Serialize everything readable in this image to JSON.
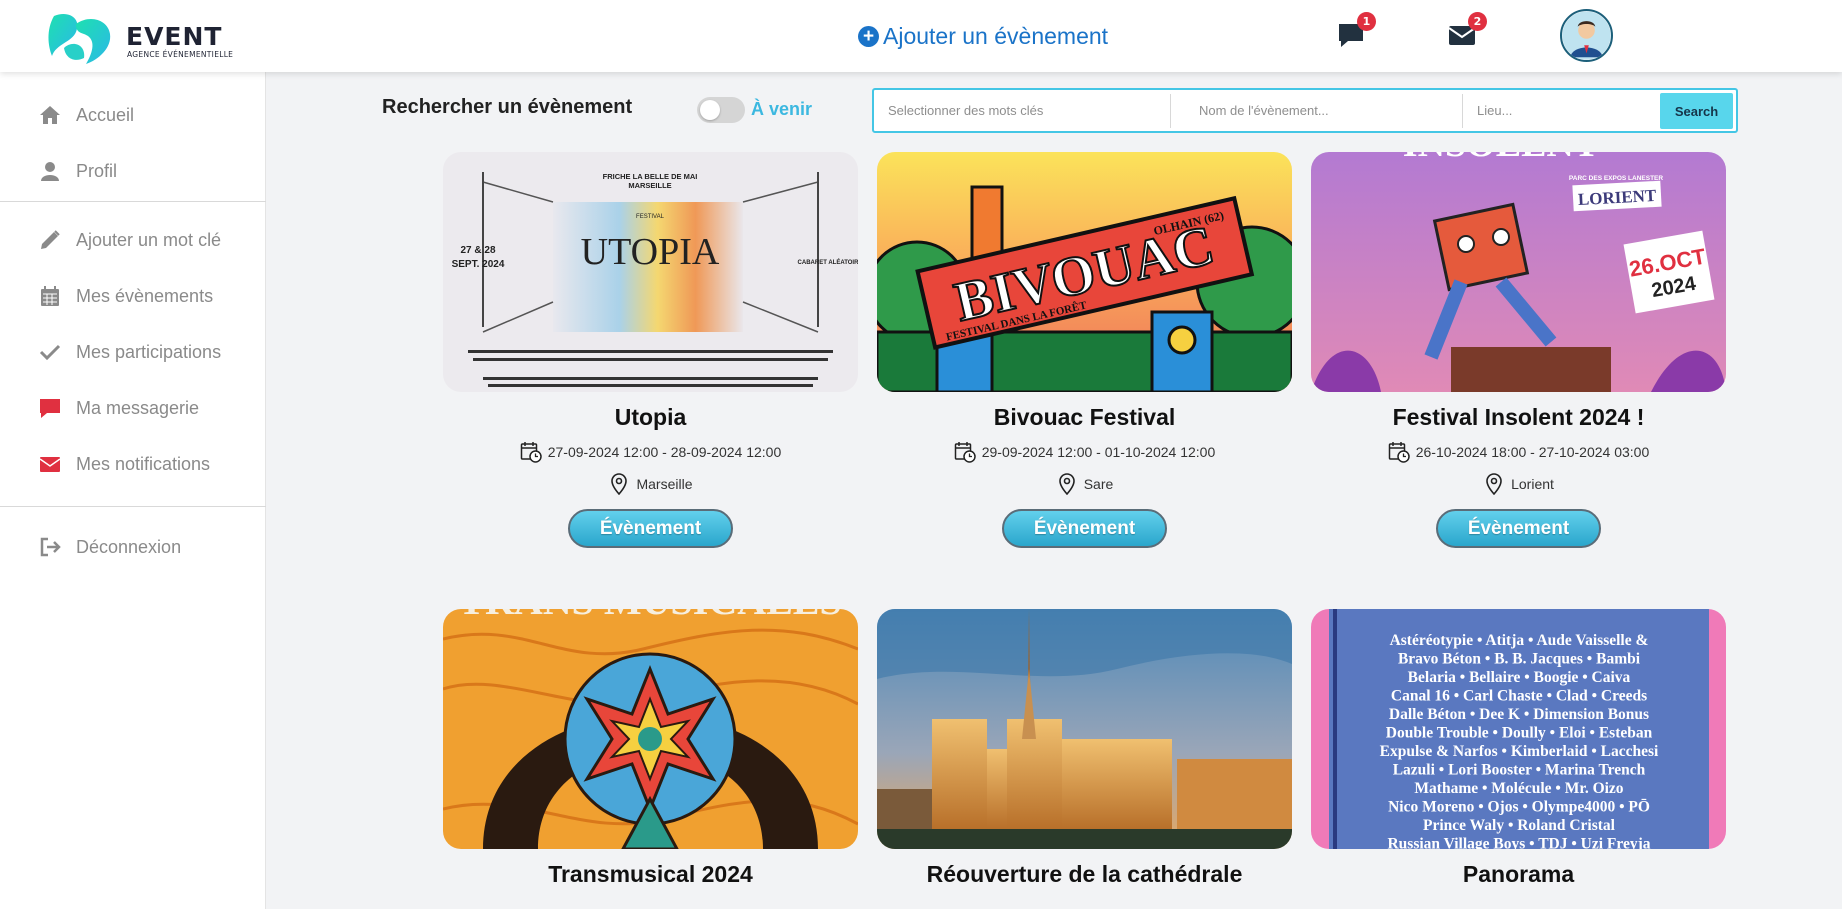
{
  "header": {
    "logo_title": "EVENT",
    "logo_subtitle": "AGENCE ÉVÉNEMENTIELLE",
    "add_event_label": "Ajouter un évènement",
    "messages_badge": "1",
    "mail_badge": "2"
  },
  "sidebar": {
    "items": [
      {
        "label": "Accueil",
        "icon": "home-icon"
      },
      {
        "label": "Profil",
        "icon": "user-icon"
      },
      {
        "label": "Ajouter un mot clé",
        "icon": "pencil-icon"
      },
      {
        "label": "Mes évènements",
        "icon": "calendar-icon"
      },
      {
        "label": "Mes participations",
        "icon": "check-icon"
      },
      {
        "label": "Ma messagerie",
        "icon": "chat-icon"
      },
      {
        "label": "Mes notifications",
        "icon": "envelope-icon"
      },
      {
        "label": "Déconnexion",
        "icon": "logout-icon"
      }
    ]
  },
  "search": {
    "title": "Rechercher un évènement",
    "toggle_label": "À venir",
    "keywords_placeholder": "Selectionner des mots clés",
    "name_placeholder": "Nom de l'évènement...",
    "place_placeholder": "Lieu...",
    "button_label": "Search"
  },
  "events": [
    {
      "title": "Utopia",
      "dates": "27-09-2024 12:00 - 28-09-2024 12:00",
      "location": "Marseille",
      "button": "Évènement",
      "poster": {
        "top_line": "FRICHE LA BELLE DE MAI",
        "city": "MARSEILLE",
        "label": "FESTIVAL",
        "name": "UTOPIA",
        "date_left": "27 & 28",
        "date_left2": "SEPT. 2024",
        "right": "CABARET ALÉATOIRE"
      }
    },
    {
      "title": "Bivouac Festival",
      "dates": "29-09-2024 12:00 - 01-10-2024 12:00",
      "location": "Sare",
      "button": "Évènement",
      "poster": {
        "name": "BIVOUAC",
        "tagline": "FESTIVAL DANS LA FORÊT",
        "place": "OLHAIN (62)"
      }
    },
    {
      "title": "Festival Insolent 2024 !",
      "dates": "26-10-2024 18:00 - 27-10-2024 03:00",
      "location": "Lorient",
      "button": "Évènement",
      "poster": {
        "name": "INSOLENT",
        "place_small": "PARC DES EXPOS LANESTER",
        "place": "LORIENT",
        "date": "26.OCT",
        "year": "2024"
      }
    },
    {
      "title": "Transmusical 2024",
      "poster": {
        "name": "TRANS MUSICALES"
      }
    },
    {
      "title": "Réouverture de la cathédrale"
    },
    {
      "title": "Panorama",
      "poster": {
        "lines": [
          "Astéréotypie • Atitja • Aude Vaisselle &",
          "Bravo Béton • B. B. Jacques • Bambi",
          "Belaria • Bellaire • Boogie • Caiva",
          "Canal 16 • Carl Chaste • Clad • Creeds",
          "Dalle Béton • Dee K • Dimension Bonus",
          "Double Trouble • Doully • Eloi • Esteban",
          "Expulse & Narfos • Kimberlaid • Lacchesi",
          "Lazuli • Lori Booster • Marina Trench",
          "Mathame • Molécule • Mr. Oizo",
          "Nico Moreno • Ojos • Olympe4000 • PŌ",
          "Prince Waly • Roland Cristal",
          "Russian Village Boys • TDJ • Uzi Freyja"
        ]
      }
    }
  ],
  "colors": {
    "accent": "#3cb8e0",
    "link": "#1a73c8",
    "badge": "#e03040",
    "button": "#2aa6cc"
  }
}
